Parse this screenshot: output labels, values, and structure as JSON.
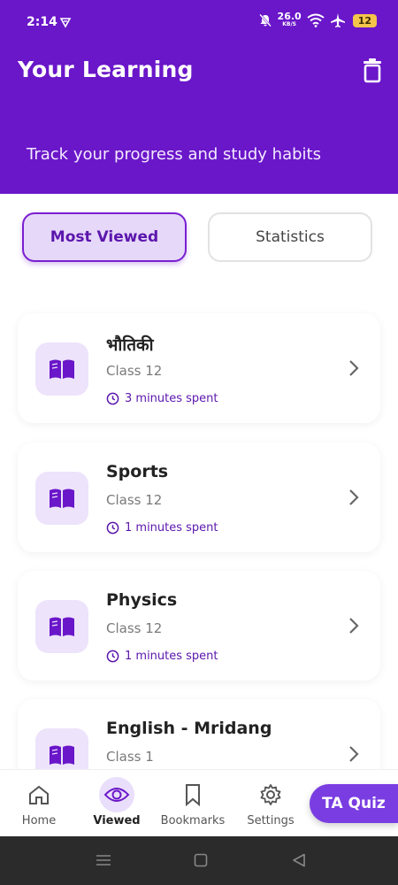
{
  "status_bar": {
    "time": "2:14",
    "speed_value": "26.0",
    "speed_unit": "KB/S",
    "battery": "12"
  },
  "header": {
    "title": "Your Learning",
    "subtitle": "Track your progress and study habits"
  },
  "tabs": [
    {
      "label": "Most Viewed",
      "active": true
    },
    {
      "label": "Statistics",
      "active": false
    }
  ],
  "items": [
    {
      "name": "भौतिकी",
      "class": "Class 12",
      "time": "3 minutes spent"
    },
    {
      "name": "Sports",
      "class": "Class 12",
      "time": "1 minutes spent"
    },
    {
      "name": "Physics",
      "class": "Class 12",
      "time": "1 minutes spent"
    },
    {
      "name": "English - Mridang",
      "class": "Class 1",
      "time": ""
    }
  ],
  "bottom_nav": [
    {
      "label": "Home",
      "icon": "home-icon"
    },
    {
      "label": "Viewed",
      "icon": "eye-icon"
    },
    {
      "label": "Bookmarks",
      "icon": "bookmark-icon"
    },
    {
      "label": "Settings",
      "icon": "gear-icon"
    }
  ],
  "quiz_button": "TA Quiz",
  "colors": {
    "primary": "#6a16c9",
    "accent_light": "#ede3fb",
    "quiz": "#7a3de2"
  }
}
